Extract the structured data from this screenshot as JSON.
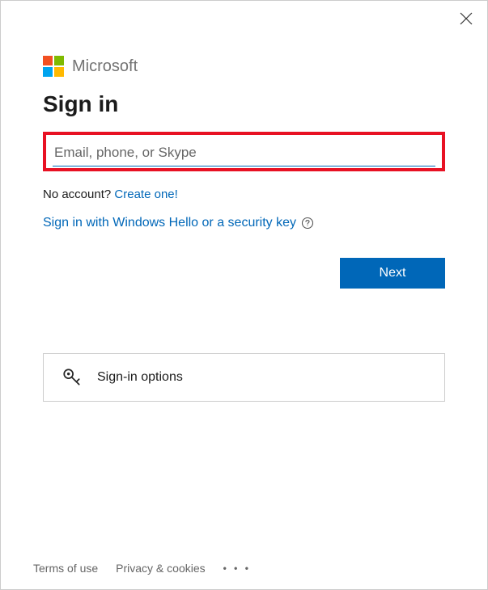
{
  "brand": {
    "name": "Microsoft"
  },
  "title": "Sign in",
  "input": {
    "placeholder": "Email, phone, or Skype",
    "value": ""
  },
  "no_account": {
    "text": "No account?",
    "link": "Create one!"
  },
  "security_link": "Sign in with Windows Hello or a security key",
  "next_button": "Next",
  "signin_options": "Sign-in options",
  "footer": {
    "terms": "Terms of use",
    "privacy": "Privacy & cookies"
  }
}
